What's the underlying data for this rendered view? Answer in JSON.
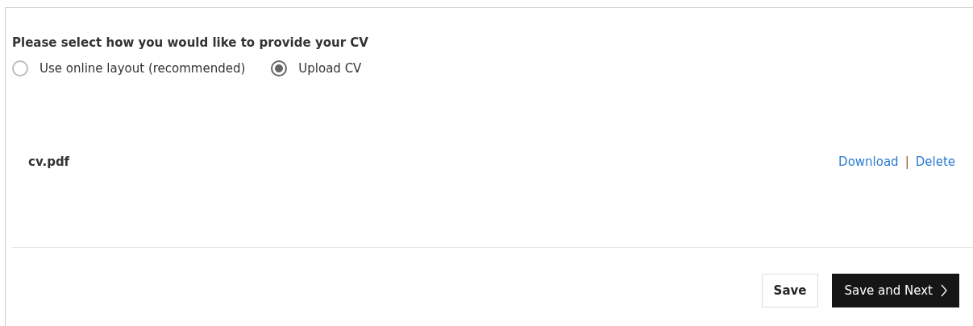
{
  "question": "Please select how you would like to provide your CV",
  "options": [
    {
      "label": "Use online layout (recommended)",
      "selected": false
    },
    {
      "label": "Upload CV",
      "selected": true
    }
  ],
  "file": {
    "name": "cv.pdf",
    "actions": [
      "Download",
      "Delete"
    ],
    "separator": "|"
  },
  "buttons": [
    {
      "label": "Save",
      "kind": "secondary"
    },
    {
      "label": "Save and Next",
      "kind": "primary"
    }
  ]
}
